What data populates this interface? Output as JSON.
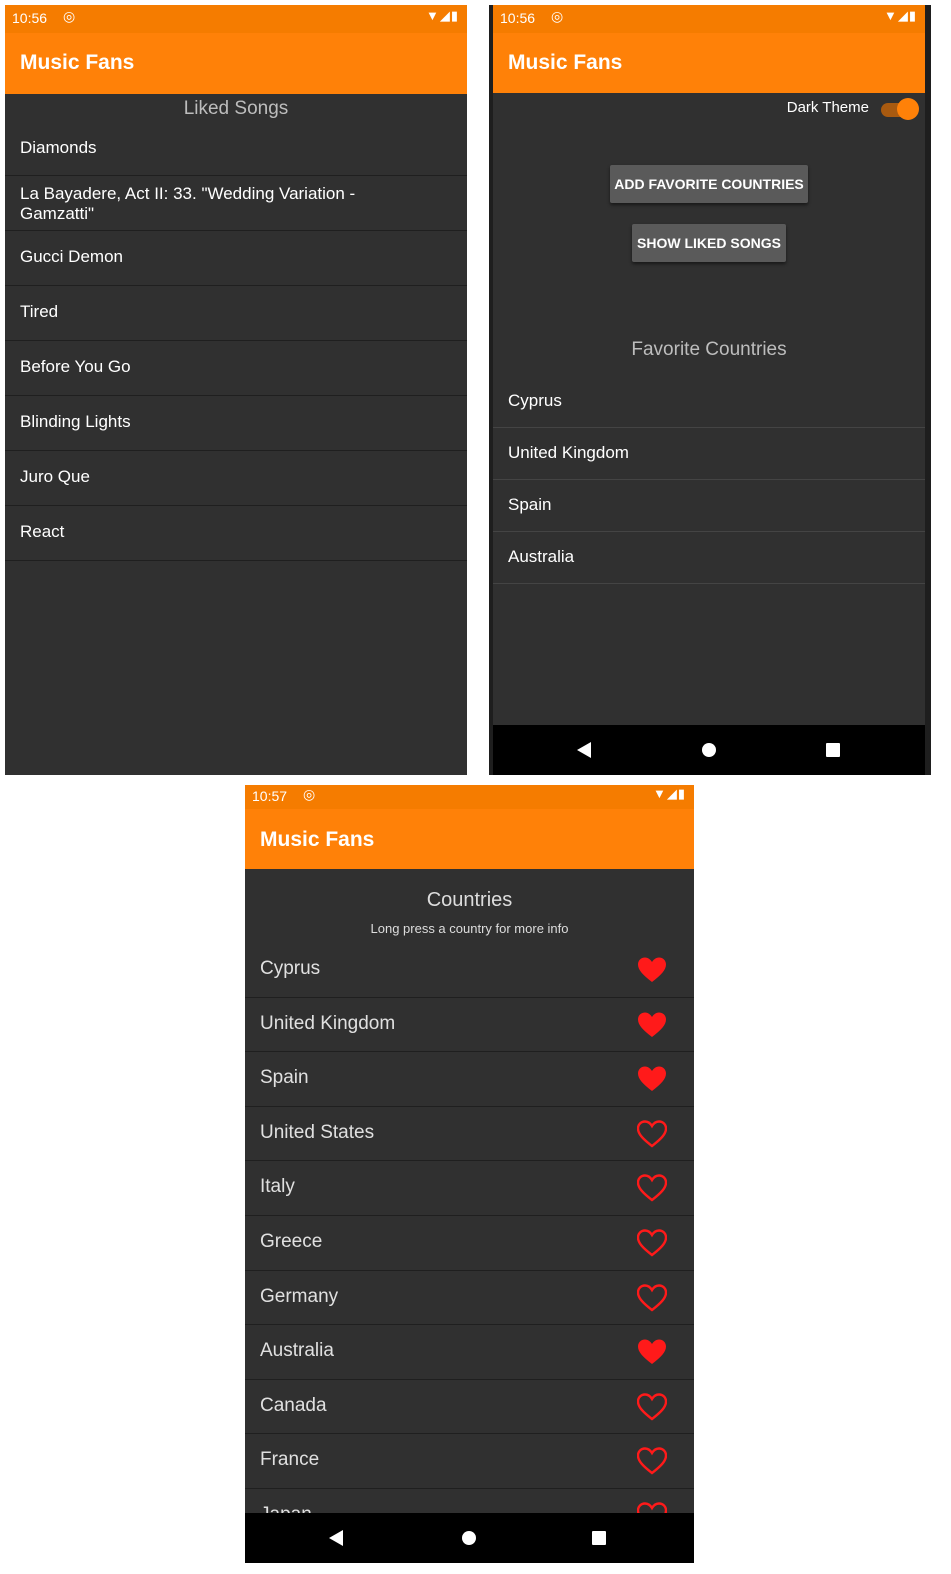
{
  "app_title": "Music Fans",
  "screen1": {
    "status_time": "10:56",
    "section_title": "Liked Songs",
    "songs": [
      "Diamonds",
      "La Bayadere, Act II: 33. \"Wedding Variation - Gamzatti\"",
      "Gucci Demon",
      "Tired",
      "Before You Go",
      "Blinding Lights",
      "Juro Que",
      "React"
    ]
  },
  "screen2": {
    "status_time": "10:56",
    "dark_theme_label": "Dark Theme",
    "dark_theme_on": true,
    "add_button_label": "ADD FAVORITE COUNTRIES",
    "show_button_label": "SHOW LIKED SONGS",
    "section_title": "Favorite Countries",
    "countries": [
      "Cyprus",
      "United Kingdom",
      "Spain",
      "Australia"
    ]
  },
  "screen3": {
    "status_time": "10:57",
    "section_title": "Countries",
    "subtitle": "Long press a country for more info",
    "countries": [
      {
        "name": "Cyprus",
        "liked": true
      },
      {
        "name": "United Kingdom",
        "liked": true
      },
      {
        "name": "Spain",
        "liked": true
      },
      {
        "name": "United States",
        "liked": false
      },
      {
        "name": "Italy",
        "liked": false
      },
      {
        "name": "Greece",
        "liked": false
      },
      {
        "name": "Germany",
        "liked": false
      },
      {
        "name": "Australia",
        "liked": true
      },
      {
        "name": "Canada",
        "liked": false
      },
      {
        "name": "France",
        "liked": false
      },
      {
        "name": "Japan",
        "liked": false
      }
    ]
  },
  "colors": {
    "accent": "#ff8108",
    "status_bar": "#f57c00",
    "background": "#303030",
    "heart": "#ff1a1a"
  },
  "icons": {
    "sync": "sync-icon",
    "wifi": "wifi-icon",
    "signal": "signal-icon",
    "battery": "battery-icon"
  }
}
